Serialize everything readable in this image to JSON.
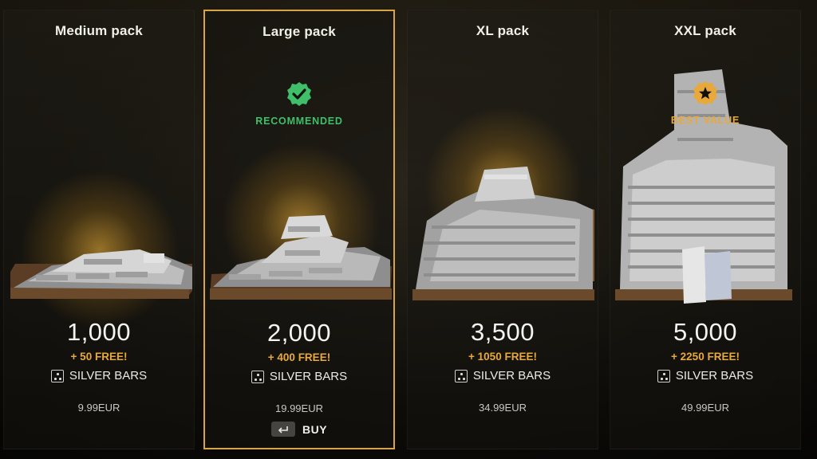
{
  "packs": [
    {
      "title": "Medium pack",
      "badge": "",
      "amount": "1,000",
      "bonus": "+ 50 FREE!",
      "currency": "SILVER BARS",
      "price": "9.99EUR"
    },
    {
      "title": "Large pack",
      "badge": "RECOMMENDED",
      "amount": "2,000",
      "bonus": "+ 400 FREE!",
      "currency": "SILVER BARS",
      "price": "19.99EUR",
      "selected": true
    },
    {
      "title": "XL pack",
      "badge": "",
      "amount": "3,500",
      "bonus": "+ 1050 FREE!",
      "currency": "SILVER BARS",
      "price": "34.99EUR"
    },
    {
      "title": "XXL pack",
      "badge": "BEST VALUE",
      "amount": "5,000",
      "bonus": "+ 2250 FREE!",
      "currency": "SILVER BARS",
      "price": "49.99EUR"
    }
  ],
  "buy": {
    "label": "BUY",
    "key_icon": "enter-key-icon"
  },
  "colors": {
    "accent": "#d9a441",
    "bonus": "#e9a93a",
    "recommended": "#3fbf6a",
    "best_value": "#e9a93a"
  },
  "icons": {
    "recommended": "checkmark-badge-icon",
    "best_value": "star-badge-icon",
    "currency": "silver-bars-icon"
  }
}
